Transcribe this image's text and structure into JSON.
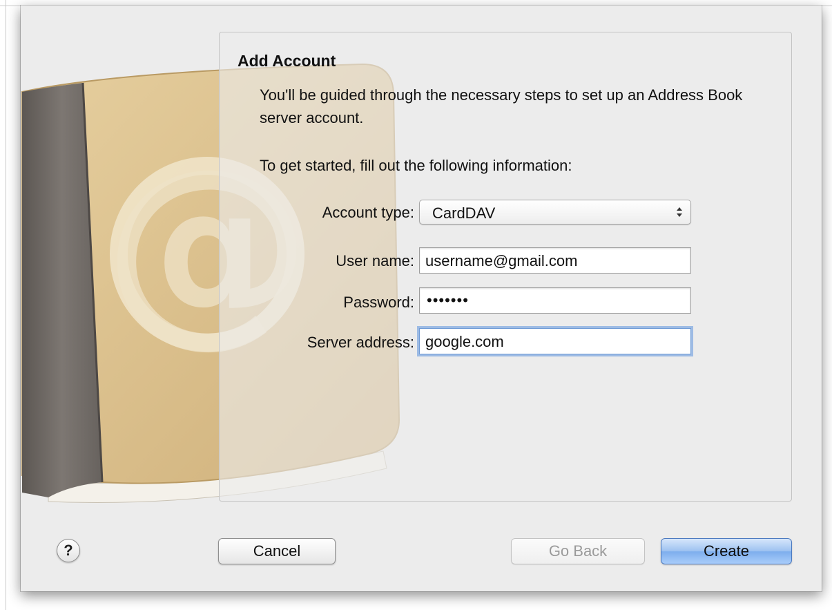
{
  "dialog": {
    "title": "Add Account",
    "intro": "You'll be guided through the necessary steps to set up an Address Book server account.",
    "prompt": "To get started, fill out the following information:"
  },
  "form": {
    "account_type": {
      "label": "Account type:",
      "value": "CardDAV"
    },
    "user_name": {
      "label": "User name:",
      "value": "username@gmail.com"
    },
    "password": {
      "label": "Password:",
      "value": "•••••••"
    },
    "server_address": {
      "label": "Server address:",
      "value": "google.com"
    }
  },
  "buttons": {
    "help": "?",
    "cancel": "Cancel",
    "go_back": "Go Back",
    "create": "Create"
  },
  "artwork": {
    "icon": "address-book-icon",
    "symbol": "@"
  },
  "colors": {
    "sheet_bg": "#ececec",
    "focus_ring": "#73a2e1",
    "default_button": "#7eaeed",
    "book_cover": "#d9c08f",
    "book_spine": "#6f6a66"
  }
}
